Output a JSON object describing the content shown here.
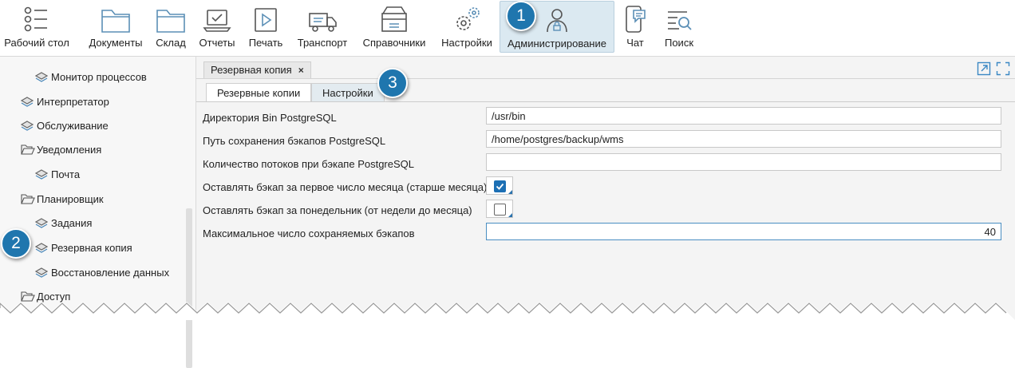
{
  "toolbar": {
    "items": [
      {
        "label": "Рабочий стол",
        "icon": "workspace-list-icon"
      },
      {
        "label": "Документы",
        "icon": "folder-icon"
      },
      {
        "label": "Склад",
        "icon": "folder-icon"
      },
      {
        "label": "Отчеты",
        "icon": "laptop-check-icon"
      },
      {
        "label": "Печать",
        "icon": "play-frame-icon"
      },
      {
        "label": "Транспорт",
        "icon": "truck-icon"
      },
      {
        "label": "Справочники",
        "icon": "archive-box-icon"
      },
      {
        "label": "Настройки",
        "icon": "gears-icon"
      },
      {
        "label": "Администрирование",
        "icon": "user-lock-icon",
        "active": true
      },
      {
        "label": "Чат",
        "icon": "phone-chat-icon"
      },
      {
        "label": "Поиск",
        "icon": "search-list-icon"
      }
    ]
  },
  "badges": {
    "one": "1",
    "two": "2",
    "three": "3"
  },
  "sidebar": {
    "items": [
      {
        "label": "Монитор процессов",
        "icon": "layers-icon"
      },
      {
        "label": "Интерпретатор",
        "icon": "layers-icon"
      },
      {
        "label": "Обслуживание",
        "icon": "layers-icon"
      },
      {
        "label": "Уведомления",
        "icon": "folder-open-icon"
      },
      {
        "label": "Почта",
        "icon": "layers-icon"
      },
      {
        "label": "Планировщик",
        "icon": "folder-open-icon"
      },
      {
        "label": "Задания",
        "icon": "layers-icon"
      },
      {
        "label": "Резервная копия",
        "icon": "layers-icon"
      },
      {
        "label": "Восстановление данных",
        "icon": "layers-icon"
      },
      {
        "label": "Доступ",
        "icon": "folder-open-icon"
      }
    ]
  },
  "main": {
    "doc_tab": {
      "label": "Резервная копия",
      "close": "×"
    },
    "sub_tabs": [
      {
        "label": "Резервные копии"
      },
      {
        "label": "Настройки"
      }
    ],
    "form": {
      "bin_dir": {
        "label": "Директория Bin PostgreSQL",
        "value": "/usr/bin"
      },
      "backup_path": {
        "label": "Путь сохранения бэкапов PostgreSQL",
        "value": "/home/postgres/backup/wms"
      },
      "threads": {
        "label": "Количество потоков при бэкапе PostgreSQL",
        "value": ""
      },
      "keep_first": {
        "label": "Оставлять бэкап за первое число месяца (старше месяца)",
        "checked": true
      },
      "keep_monday": {
        "label": "Оставлять бэкап за понедельник (от недели до месяца)",
        "checked": false
      },
      "max_backups": {
        "label": "Максимальное число сохраняемых бэкапов",
        "value": "40"
      }
    }
  },
  "colors": {
    "accent": "#1f76ae",
    "active_tab": "#dbe9f1",
    "check": "#1c6fb4"
  }
}
